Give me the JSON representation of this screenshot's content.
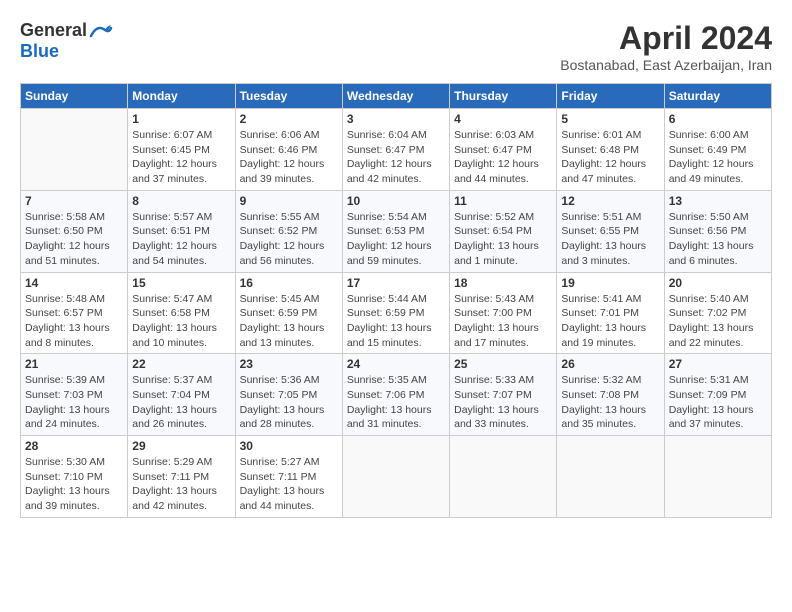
{
  "logo": {
    "general": "General",
    "blue": "Blue"
  },
  "title": "April 2024",
  "location": "Bostanabad, East Azerbaijan, Iran",
  "weekdays": [
    "Sunday",
    "Monday",
    "Tuesday",
    "Wednesday",
    "Thursday",
    "Friday",
    "Saturday"
  ],
  "weeks": [
    [
      {
        "day": "",
        "info": ""
      },
      {
        "day": "1",
        "info": "Sunrise: 6:07 AM\nSunset: 6:45 PM\nDaylight: 12 hours\nand 37 minutes."
      },
      {
        "day": "2",
        "info": "Sunrise: 6:06 AM\nSunset: 6:46 PM\nDaylight: 12 hours\nand 39 minutes."
      },
      {
        "day": "3",
        "info": "Sunrise: 6:04 AM\nSunset: 6:47 PM\nDaylight: 12 hours\nand 42 minutes."
      },
      {
        "day": "4",
        "info": "Sunrise: 6:03 AM\nSunset: 6:47 PM\nDaylight: 12 hours\nand 44 minutes."
      },
      {
        "day": "5",
        "info": "Sunrise: 6:01 AM\nSunset: 6:48 PM\nDaylight: 12 hours\nand 47 minutes."
      },
      {
        "day": "6",
        "info": "Sunrise: 6:00 AM\nSunset: 6:49 PM\nDaylight: 12 hours\nand 49 minutes."
      }
    ],
    [
      {
        "day": "7",
        "info": "Sunrise: 5:58 AM\nSunset: 6:50 PM\nDaylight: 12 hours\nand 51 minutes."
      },
      {
        "day": "8",
        "info": "Sunrise: 5:57 AM\nSunset: 6:51 PM\nDaylight: 12 hours\nand 54 minutes."
      },
      {
        "day": "9",
        "info": "Sunrise: 5:55 AM\nSunset: 6:52 PM\nDaylight: 12 hours\nand 56 minutes."
      },
      {
        "day": "10",
        "info": "Sunrise: 5:54 AM\nSunset: 6:53 PM\nDaylight: 12 hours\nand 59 minutes."
      },
      {
        "day": "11",
        "info": "Sunrise: 5:52 AM\nSunset: 6:54 PM\nDaylight: 13 hours\nand 1 minute."
      },
      {
        "day": "12",
        "info": "Sunrise: 5:51 AM\nSunset: 6:55 PM\nDaylight: 13 hours\nand 3 minutes."
      },
      {
        "day": "13",
        "info": "Sunrise: 5:50 AM\nSunset: 6:56 PM\nDaylight: 13 hours\nand 6 minutes."
      }
    ],
    [
      {
        "day": "14",
        "info": "Sunrise: 5:48 AM\nSunset: 6:57 PM\nDaylight: 13 hours\nand 8 minutes."
      },
      {
        "day": "15",
        "info": "Sunrise: 5:47 AM\nSunset: 6:58 PM\nDaylight: 13 hours\nand 10 minutes."
      },
      {
        "day": "16",
        "info": "Sunrise: 5:45 AM\nSunset: 6:59 PM\nDaylight: 13 hours\nand 13 minutes."
      },
      {
        "day": "17",
        "info": "Sunrise: 5:44 AM\nSunset: 6:59 PM\nDaylight: 13 hours\nand 15 minutes."
      },
      {
        "day": "18",
        "info": "Sunrise: 5:43 AM\nSunset: 7:00 PM\nDaylight: 13 hours\nand 17 minutes."
      },
      {
        "day": "19",
        "info": "Sunrise: 5:41 AM\nSunset: 7:01 PM\nDaylight: 13 hours\nand 19 minutes."
      },
      {
        "day": "20",
        "info": "Sunrise: 5:40 AM\nSunset: 7:02 PM\nDaylight: 13 hours\nand 22 minutes."
      }
    ],
    [
      {
        "day": "21",
        "info": "Sunrise: 5:39 AM\nSunset: 7:03 PM\nDaylight: 13 hours\nand 24 minutes."
      },
      {
        "day": "22",
        "info": "Sunrise: 5:37 AM\nSunset: 7:04 PM\nDaylight: 13 hours\nand 26 minutes."
      },
      {
        "day": "23",
        "info": "Sunrise: 5:36 AM\nSunset: 7:05 PM\nDaylight: 13 hours\nand 28 minutes."
      },
      {
        "day": "24",
        "info": "Sunrise: 5:35 AM\nSunset: 7:06 PM\nDaylight: 13 hours\nand 31 minutes."
      },
      {
        "day": "25",
        "info": "Sunrise: 5:33 AM\nSunset: 7:07 PM\nDaylight: 13 hours\nand 33 minutes."
      },
      {
        "day": "26",
        "info": "Sunrise: 5:32 AM\nSunset: 7:08 PM\nDaylight: 13 hours\nand 35 minutes."
      },
      {
        "day": "27",
        "info": "Sunrise: 5:31 AM\nSunset: 7:09 PM\nDaylight: 13 hours\nand 37 minutes."
      }
    ],
    [
      {
        "day": "28",
        "info": "Sunrise: 5:30 AM\nSunset: 7:10 PM\nDaylight: 13 hours\nand 39 minutes."
      },
      {
        "day": "29",
        "info": "Sunrise: 5:29 AM\nSunset: 7:11 PM\nDaylight: 13 hours\nand 42 minutes."
      },
      {
        "day": "30",
        "info": "Sunrise: 5:27 AM\nSunset: 7:11 PM\nDaylight: 13 hours\nand 44 minutes."
      },
      {
        "day": "",
        "info": ""
      },
      {
        "day": "",
        "info": ""
      },
      {
        "day": "",
        "info": ""
      },
      {
        "day": "",
        "info": ""
      }
    ]
  ]
}
